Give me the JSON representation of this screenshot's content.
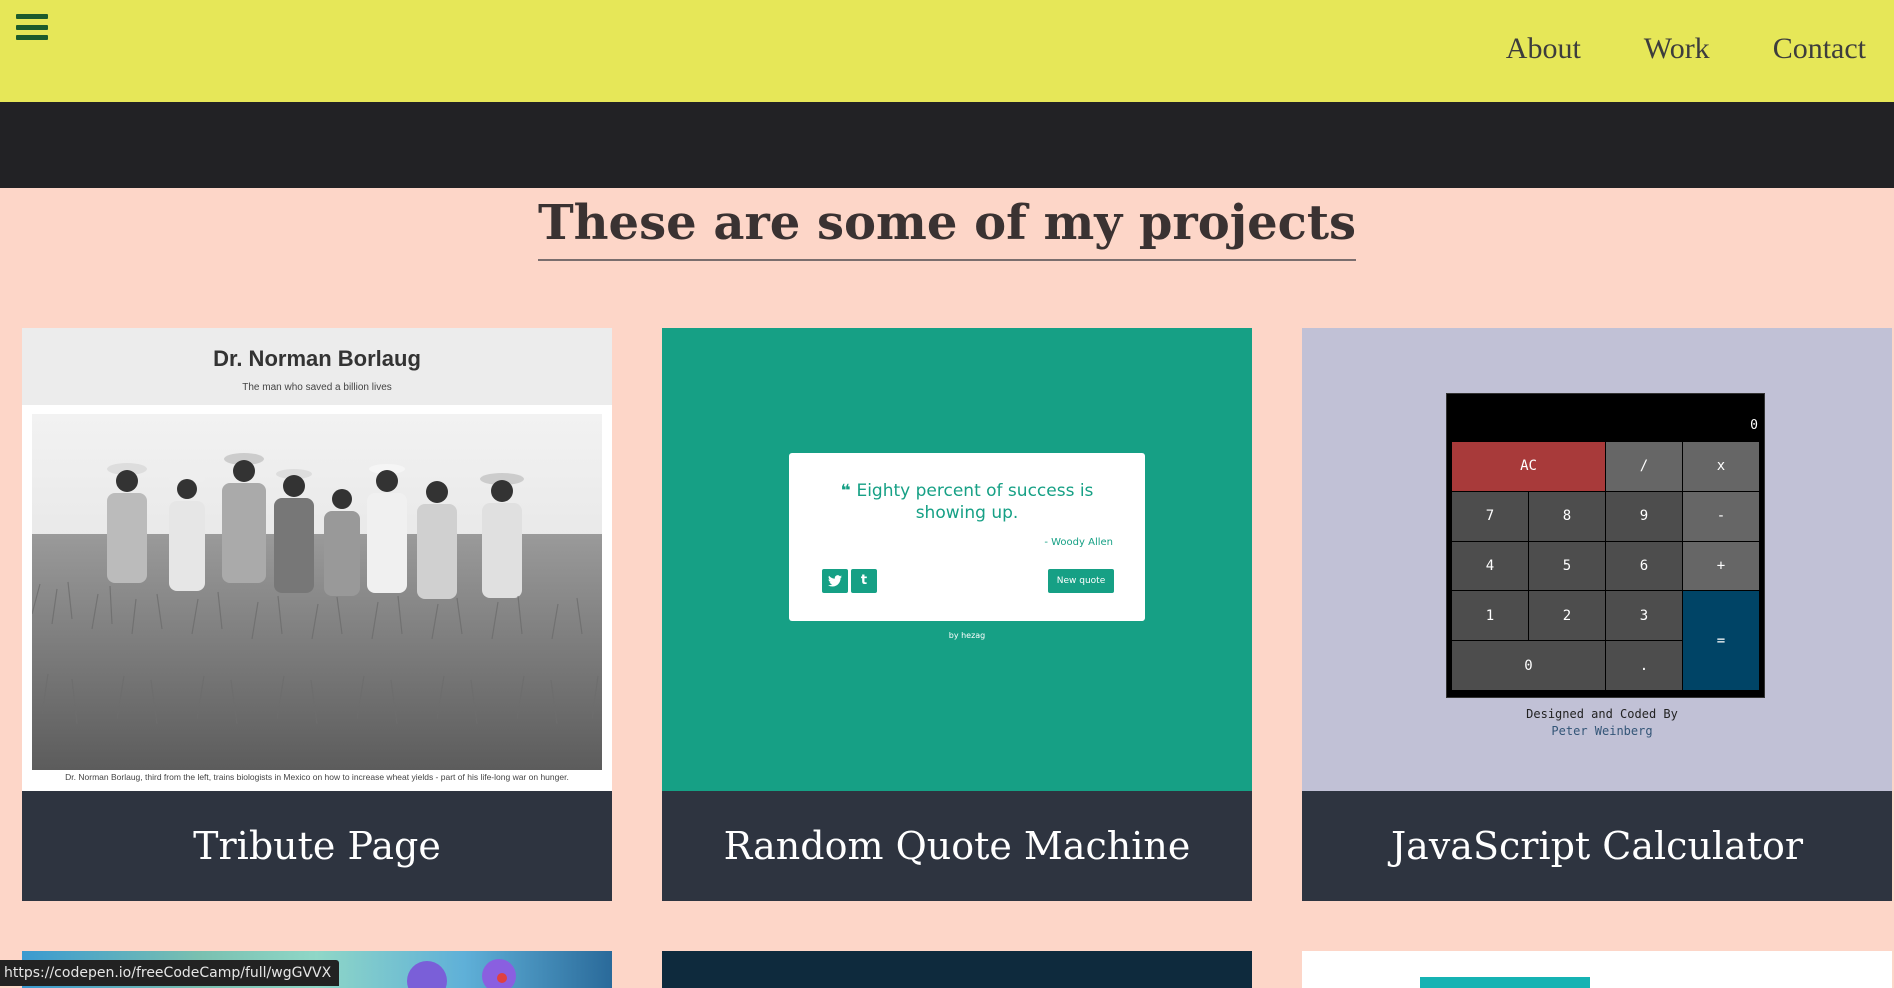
{
  "navbar": {
    "menu_icon": "hamburger-menu-icon",
    "links": [
      "About",
      "Work",
      "Contact"
    ],
    "background": "#e6e758"
  },
  "section": {
    "title": "These are some of my projects"
  },
  "projects": [
    {
      "title": "Tribute Page",
      "thumbnail": {
        "heading": "Dr. Norman Borlaug",
        "subheading": "The man who saved a billion lives",
        "caption": "Dr. Norman Borlaug, third from the left, trains biologists in Mexico on how to increase wheat yields - part of his life-long war on hunger."
      }
    },
    {
      "title": "Random Quote Machine",
      "thumbnail": {
        "quote_icon": "quote-icon",
        "quote": "Eighty percent of success is showing up.",
        "author": "- Woody Allen",
        "tweet_label": "twitter-icon",
        "tumblr_label": "t",
        "new_quote_label": "New quote",
        "byline": "by hezag"
      }
    },
    {
      "title": "JavaScript Calculator",
      "thumbnail": {
        "display": "0",
        "keys": [
          "AC",
          "/",
          "x",
          "7",
          "8",
          "9",
          "-",
          "4",
          "5",
          "6",
          "+",
          "1",
          "2",
          "3",
          "=",
          "0",
          "."
        ],
        "credit_line1": "Designed and Coded By",
        "credit_line2": "Peter Weinberg"
      }
    }
  ],
  "status_bar": {
    "url": "https://codepen.io/freeCodeCamp/full/wgGVVX"
  },
  "colors": {
    "page_background": "#fdd6c8",
    "dark_band": "#222225",
    "caption_background": "#2e3440",
    "quote_green": "#16a085",
    "calculator_bg": "#c1c1d6"
  }
}
